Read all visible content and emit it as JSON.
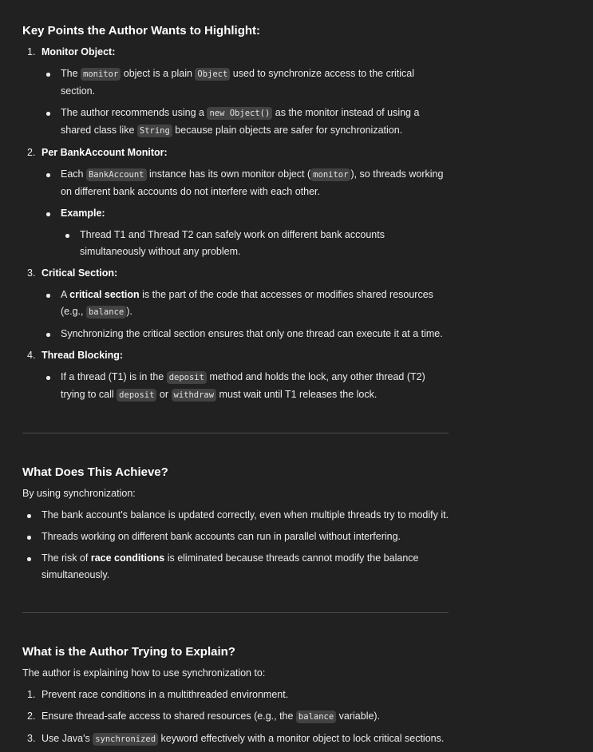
{
  "section1": {
    "heading": "Key Points the Author Wants to Highlight:",
    "items": [
      {
        "num": "1.",
        "title": "Monitor Object:",
        "bullets": [
          {
            "t1": "The ",
            "c1": "monitor",
            "t2": " object is a plain ",
            "c2": "Object",
            "t3": " used to synchronize access to the critical section."
          },
          {
            "t1": "The author recommends using a ",
            "c1": "new Object()",
            "t2": " as the monitor instead of using a shared class like ",
            "c2": "String",
            "t3": " because plain objects are safer for synchronization."
          }
        ]
      },
      {
        "num": "2.",
        "title": "Per BankAccount Monitor:",
        "bullets": [
          {
            "t1": "Each ",
            "c1": "BankAccount",
            "t2": " instance has its own monitor object (",
            "c2": "monitor",
            "t3": "), so threads working on different bank accounts do not interfere with each other."
          },
          {
            "label": "Example:"
          }
        ],
        "sub_bullets": [
          "Thread T1 and Thread T2 can safely work on different bank accounts simultaneously without any problem."
        ]
      },
      {
        "num": "3.",
        "title": "Critical Section:",
        "bullets": [
          {
            "t1": "A ",
            "b1": "critical section",
            "t2": " is the part of the code that accesses or modifies shared resources (e.g., ",
            "c1": "balance",
            "t3": ")."
          },
          {
            "text": "Synchronizing the critical section ensures that only one thread can execute it at a time."
          }
        ]
      },
      {
        "num": "4.",
        "title": "Thread Blocking:",
        "bullets": [
          {
            "t1": "If a thread (T1) is in the ",
            "c1": "deposit",
            "t2": " method and holds the lock, any other thread (T2) trying to call ",
            "c2": "deposit",
            "t3": " or ",
            "c3": "withdraw",
            "t4": " must wait until T1 releases the lock."
          }
        ]
      }
    ]
  },
  "section2": {
    "heading": "What Does This Achieve?",
    "intro": "By using synchronization:",
    "bullets": [
      {
        "text": "The bank account's balance is updated correctly, even when multiple threads try to modify it."
      },
      {
        "text": "Threads working on different bank accounts can run in parallel without interfering."
      },
      {
        "t1": "The risk of ",
        "b1": "race conditions",
        "t2": " is eliminated because threads cannot modify the balance simultaneously."
      }
    ]
  },
  "section3": {
    "heading": "What is the Author Trying to Explain?",
    "intro": "The author is explaining how to use synchronization to:",
    "items": [
      {
        "num": "1.",
        "text": "Prevent race conditions in a multithreaded environment."
      },
      {
        "num": "2.",
        "t1": "Ensure thread-safe access to shared resources (e.g., the ",
        "c1": "balance",
        "t2": " variable)."
      },
      {
        "num": "3.",
        "t1": "Use Java's ",
        "c1": "synchronized",
        "t2": " keyword effectively with a monitor object to lock critical sections."
      }
    ]
  }
}
